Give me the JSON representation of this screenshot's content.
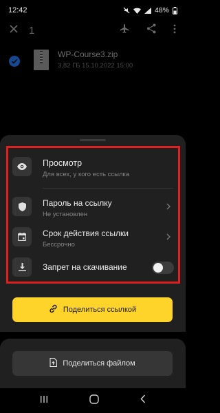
{
  "status_bar": {
    "time": "12:42",
    "battery": "48%"
  },
  "app_bar": {
    "selected_count": "1"
  },
  "file": {
    "name": "WP-Course3.zip",
    "meta": "3,82 ГБ 15.10.2022 15:00"
  },
  "sheet": {
    "view": {
      "title": "Просмотр",
      "subtitle": "Для всех, у кого есть ссылка"
    },
    "password": {
      "title": "Пароль на ссылку",
      "subtitle": "Не установлен"
    },
    "expiry": {
      "title": "Срок действия ссылки",
      "subtitle": "Бессрочно"
    },
    "download_ban": {
      "title": "Запрет на скачивание",
      "enabled": false
    },
    "share_link_label": "Поделиться ссылкой"
  },
  "share_file_label": "Поделиться файлом",
  "colors": {
    "accent": "#fed42b",
    "highlight": "#e01f1f",
    "background": "#000000",
    "sheet": "#202020"
  }
}
